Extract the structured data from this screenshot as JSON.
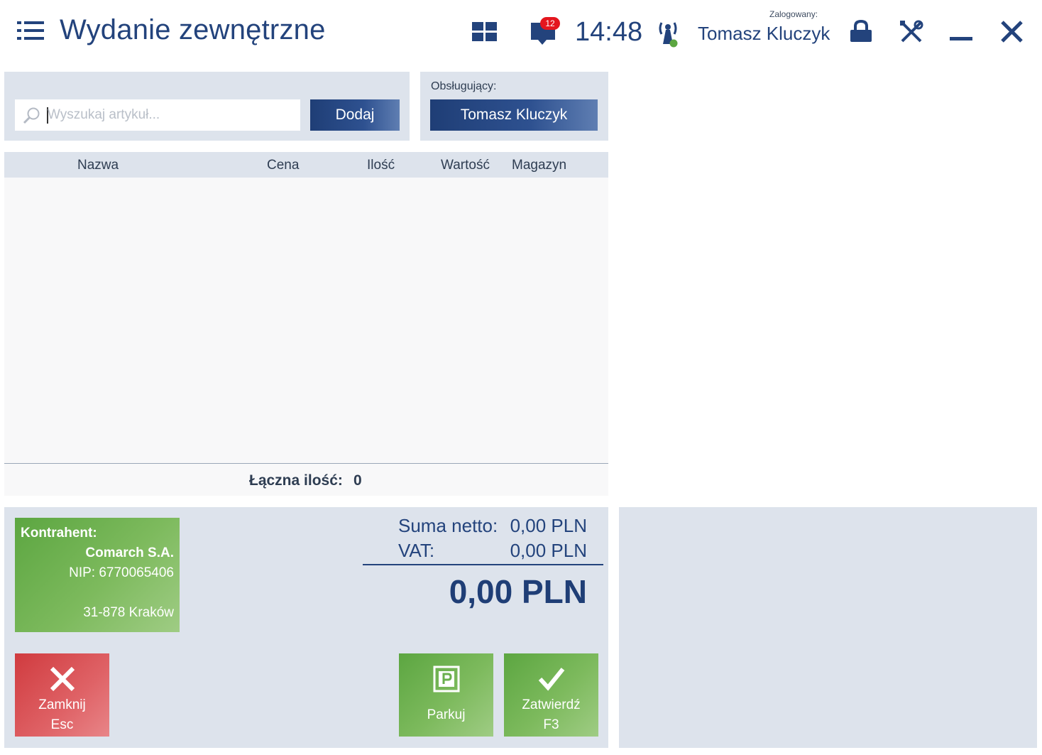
{
  "header": {
    "title": "Wydanie zewnętrzne",
    "notifications_count": "12",
    "clock": "14:48",
    "login_label": "Zalogowany:",
    "user_name": "Tomasz Kluczyk"
  },
  "search": {
    "placeholder": "Wyszukaj artykuł...",
    "value": "",
    "add_label": "Dodaj"
  },
  "operator": {
    "label": "Obsługujący:",
    "name": "Tomasz Kluczyk"
  },
  "table": {
    "columns": [
      "Nazwa",
      "Cena",
      "Ilość",
      "Wartość",
      "Magazyn"
    ],
    "rows": [],
    "total_qty_label": "Łączna ilość:",
    "total_qty_value": "0"
  },
  "contractor": {
    "label": "Kontrahent:",
    "name": "Comarch S.A.",
    "nip": "NIP: 6770065406",
    "address": "31-878  Kraków"
  },
  "summary": {
    "net_label": "Suma netto:",
    "net_value": "0,00 PLN",
    "vat_label": "VAT:",
    "vat_value": "0,00 PLN",
    "total": "0,00 PLN"
  },
  "actions": {
    "close_label": "Zamknij",
    "close_key": "Esc",
    "park_label": "Parkuj",
    "confirm_label": "Zatwierdź",
    "confirm_key": "F3"
  },
  "icons": {
    "menu": "hamburger-menu-icon",
    "grid": "grid-icon",
    "notifications": "chat-bubble-icon",
    "connection": "antenna-icon",
    "lock": "lock-icon",
    "settings": "tools-icon",
    "minimize": "minimize-icon",
    "close": "close-icon"
  },
  "colors": {
    "brand_blue": "#23437c",
    "panel_bg": "#dde3ec",
    "green_tile": "#7dba5d",
    "red_tile": "#df6266",
    "badge_red": "#e4161e",
    "online_dot": "#5ca641"
  }
}
